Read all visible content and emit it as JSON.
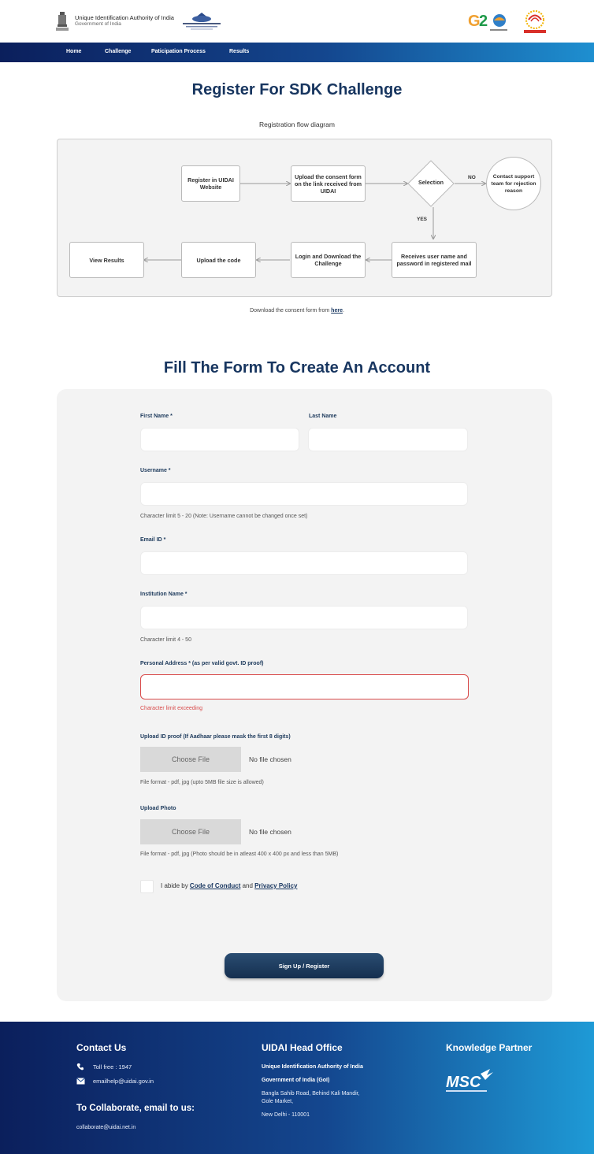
{
  "header": {
    "org_name": "Unique Identification Authority of India",
    "org_sub": "Government of India",
    "logos": [
      "emblem-icon",
      "iiit-logo",
      "g20-logo",
      "aadhaar-logo"
    ]
  },
  "nav": {
    "items": [
      {
        "label": "Home"
      },
      {
        "label": "Challenge"
      },
      {
        "label": "Paticipation Process"
      },
      {
        "label": "Results"
      }
    ]
  },
  "register": {
    "title": "Register For SDK Challenge",
    "diagram_caption": "Registration flow diagram"
  },
  "flow": {
    "register": "Register in UIDAI Website",
    "upload_consent": "Upload the consent form on the link received from UIDAI",
    "selection": "Selection",
    "no": "NO",
    "yes": "YES",
    "contact": "Contact support team for rejection reason",
    "receives": "Receives user name and password in registered mail",
    "login": "Login and Download the Challenge",
    "upload_code": "Upload the code",
    "view_results": "View Results"
  },
  "consent": {
    "text": "Download the consent form from ",
    "link": "here",
    "suffix": "."
  },
  "form": {
    "title": "Fill The Form To Create An Account",
    "first_name_label": "First Name *",
    "last_name_label": "Last Name",
    "username_label": "Username *",
    "username_hint": "Character limit 5 - 20  (Note: Username cannot be changed once set)",
    "email_label": "Email ID *",
    "institution_label": "Institution Name *",
    "institution_hint": "Character limit 4 - 50",
    "address_label": "Personal Address * (as per valid govt. ID proof)",
    "address_error": "Character limit exceeding",
    "id_proof_label": "Upload ID proof (If Aadhaar please mask the first 8 digits)",
    "choose_file": "Choose File",
    "no_file": "No file chosen",
    "id_proof_hint": "File format - pdf, jpg (upto 5MB file size is allowed)",
    "photo_label": "Upload Photo",
    "photo_hint": "File format - pdf, jpg (Photo should be in atleast 400 x 400 px and less than 5MB)",
    "agree_prefix": "I abide by ",
    "code_of_conduct": "Code of Conduct",
    "agree_and": " and ",
    "privacy_policy": "Privacy Policy",
    "submit": "Sign Up / Register"
  },
  "footer": {
    "contact_title": "Contact Us",
    "toll_free": "Toll free : 1947",
    "email": "emailhelp@uidai.gov.in",
    "collab_title": "To Collaborate, email to us:",
    "collab_email": "collaborate@uidai.net.in",
    "office_title": "UIDAI Head Office",
    "office_line1": "Unique Identification Authority of India",
    "office_line2": "Government of India (GoI)",
    "office_line3": "Bangla Sahib Road, Behind Kali Mandir,",
    "office_line4": "Gole Market,",
    "office_line5": "New Delhi - 110001",
    "partner_title": "Knowledge Partner"
  },
  "colors": {
    "brand_dark": "#17355f",
    "nav_start": "#0b1f5c",
    "nav_end": "#1e8fd0",
    "error": "#d94b4b"
  }
}
